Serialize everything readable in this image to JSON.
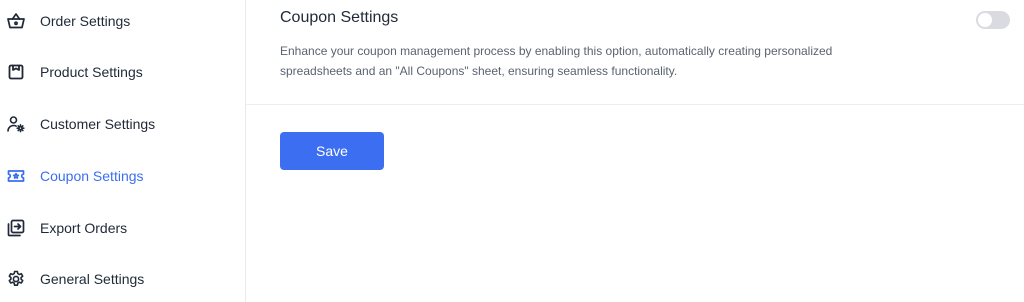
{
  "sidebar": {
    "items": [
      {
        "label": "Order Settings",
        "icon": "basket-icon",
        "active": false
      },
      {
        "label": "Product Settings",
        "icon": "product-box-icon",
        "active": false
      },
      {
        "label": "Customer Settings",
        "icon": "customer-gear-icon",
        "active": false
      },
      {
        "label": "Coupon Settings",
        "icon": "coupon-icon",
        "active": true
      },
      {
        "label": "Export Orders",
        "icon": "export-icon",
        "active": false
      },
      {
        "label": "General Settings",
        "icon": "gear-icon",
        "active": false
      }
    ],
    "active_color": "#3b6ef0"
  },
  "main": {
    "section_title": "Coupon Settings",
    "section_desc": "Enhance your coupon management process by enabling this option, automatically creating personalized spreadsheets and an \"All Coupons\" sheet, ensuring seamless functionality.",
    "toggle_on": false,
    "save_label": "Save",
    "accent": "#3b6ef0"
  }
}
